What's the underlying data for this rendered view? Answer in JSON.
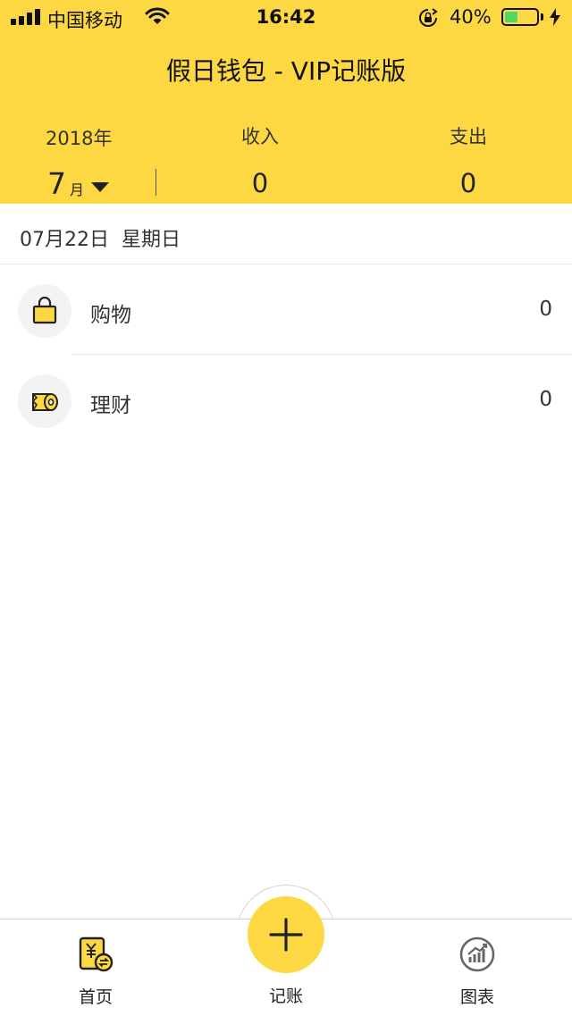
{
  "status_bar": {
    "carrier": "中国移动",
    "time": "16:42",
    "battery_percent_text": "40%",
    "battery_level": 0.4,
    "icons": [
      "signal-icon",
      "wifi-icon",
      "orientation-lock-icon",
      "battery-icon",
      "charging-bolt-icon"
    ]
  },
  "header": {
    "title": "假日钱包 - VIP记账版",
    "year": "2018年",
    "month": "7",
    "month_unit": "月",
    "income_label": "收入",
    "income_value": "0",
    "expense_label": "支出",
    "expense_value": "0"
  },
  "day": {
    "date": "07月22日",
    "weekday": "星期日"
  },
  "records": [
    {
      "icon": "shopping-bag-icon",
      "name": "购物",
      "amount": "0"
    },
    {
      "icon": "finance-scroll-icon",
      "name": "理财",
      "amount": "0"
    }
  ],
  "tabbar": {
    "home_label": "首页",
    "add_label": "记账",
    "chart_label": "图表"
  },
  "colors": {
    "accent": "#fdd843",
    "battery_green": "#4cd964",
    "text": "#333333"
  }
}
